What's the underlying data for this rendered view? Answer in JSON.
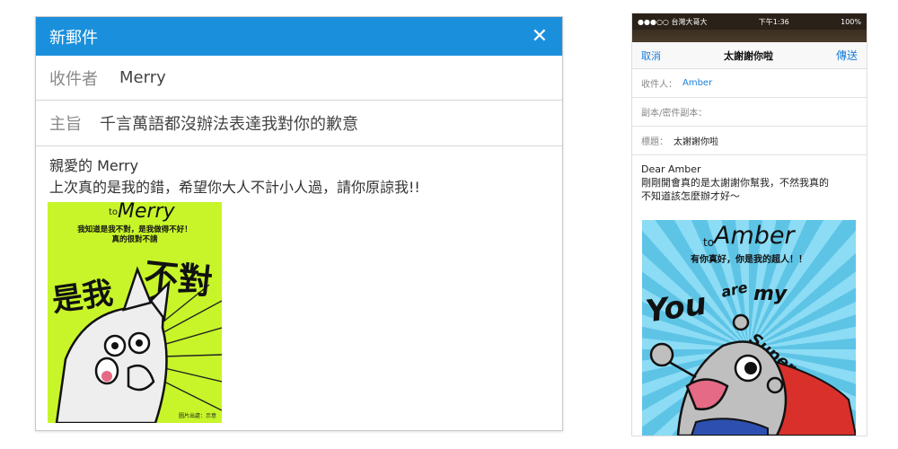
{
  "desktop": {
    "title": "新郵件",
    "close_icon": "close-icon",
    "to_label": "收件者",
    "to_value": "Merry",
    "subject_label": "主旨",
    "subject_value": "千言萬語都沒辦法表達我對你的歉意",
    "body_line1": "親愛的 Merry",
    "body_line2": "上次真的是我的錯，希望你大人不計小人過，請你原諒我!!",
    "card": {
      "to": "to",
      "name": "Merry",
      "message_line1": "我知道是我不對，是我做得不好！",
      "message_line2": "真的很對不請",
      "big_text_left": "是我",
      "big_text_right": "不對",
      "signature": "圖片出處：示意"
    },
    "colors": {
      "header": "#1a90dc",
      "card_bg": "#c7f52a"
    }
  },
  "phone": {
    "status_left": "●●●○○ 台灣大哥大",
    "status_time": "下午1:36",
    "status_right": "100%",
    "cancel": "取消",
    "title": "太謝謝你啦",
    "send": "傳送",
    "to_label": "收件人：",
    "to_value": "Amber",
    "cc_label": "副本/密件副本：",
    "subject_label": "標題：",
    "subject_value": "太謝謝你啦",
    "body_line1": "Dear Amber",
    "body_line2": "剛剛開會真的是太謝謝你幫我，不然我真的",
    "body_line3": "不知道該怎麼辦才好～",
    "card": {
      "to": "to",
      "name": "Amber",
      "message": "有你真好，你是我的超人！！",
      "you": "You",
      "are": "are",
      "my": "my",
      "superman": "Superman"
    },
    "colors": {
      "link": "#1a7fd9",
      "card_bg": "#6fd0ee"
    }
  }
}
